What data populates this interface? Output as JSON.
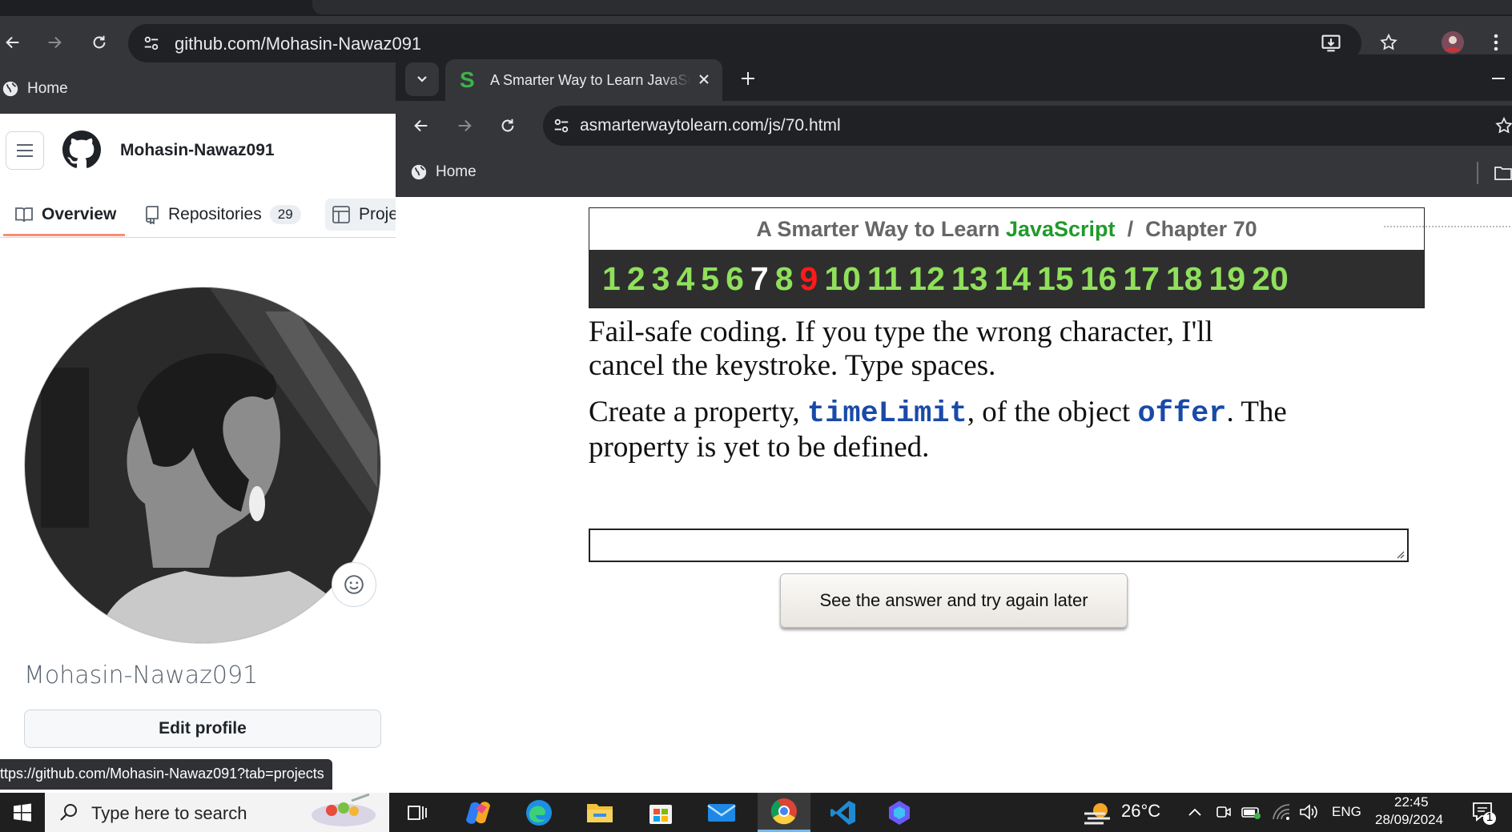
{
  "back_window": {
    "url": "github.com/Mohasin-Nawaz091",
    "bookmark_home": "Home",
    "github": {
      "username_header": "Mohasin-Nawaz091",
      "tabs": [
        {
          "label": "Overview"
        },
        {
          "label": "Repositories",
          "count": "29"
        },
        {
          "label": "Proje"
        }
      ],
      "profile_name": "Mohasin-Nawaz091",
      "edit_profile": "Edit profile"
    },
    "status_url": "ttps://github.com/Mohasin-Nawaz091?tab=projects"
  },
  "front_window": {
    "tab_title": "A Smarter Way to Learn JavaScript",
    "tab_favicon": "S",
    "url": "asmarterwaytolearn.com/js/70.html",
    "bookmark_home": "Home",
    "page": {
      "title_prefix": "A Smarter Way to Learn",
      "title_js": "JavaScript",
      "title_sep": "/",
      "title_chapter": "Chapter 70",
      "chapter_numbers": [
        "1",
        "2",
        "3",
        "4",
        "5",
        "6",
        "7",
        "8",
        "9",
        "10",
        "11",
        "12",
        "13",
        "14",
        "15",
        "16",
        "17",
        "18",
        "19",
        "20"
      ],
      "current_number": "7",
      "highlight_number": "9",
      "instruction_1": "Fail-safe coding. If you type the wrong character, I'll cancel the keystroke. Type spaces.",
      "instruction_2_pre": "Create a property, ",
      "instruction_2_code1": "timeLimit",
      "instruction_2_mid": ", of the object ",
      "instruction_2_code2": "offer",
      "instruction_2_post": ". The property is yet to be defined.",
      "answer_value": "",
      "answer_button": "See the answer and try again later"
    },
    "colors": {
      "js_green": "#1f9a2b",
      "number_green": "#8fe05a",
      "number_red": "#ff1a1a",
      "code_blue": "#1a4aa8"
    }
  },
  "taskbar": {
    "search_placeholder": "Type here to search",
    "weather": "26°C",
    "language": "ENG",
    "time": "22:45",
    "date": "28/09/2024",
    "notification_count": "1",
    "apps": [
      "task-view-icon",
      "copilot-icon",
      "edge-icon",
      "file-explorer-icon",
      "store-icon",
      "mail-icon",
      "chrome-icon",
      "vscode-icon",
      "copilot-app-icon"
    ]
  }
}
